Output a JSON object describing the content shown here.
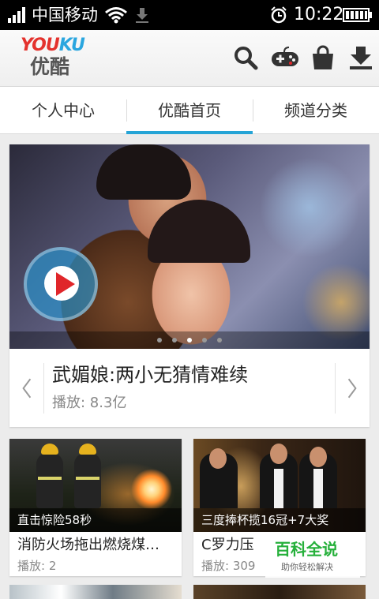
{
  "status_bar": {
    "carrier": "中国移动",
    "time": "10:22",
    "icons": [
      "signal-icon",
      "wifi-icon",
      "download-icon",
      "alarm-icon",
      "battery-icon"
    ]
  },
  "header": {
    "logo_en": "YOUKU",
    "logo_cn": "优酷",
    "brand_colors": {
      "you": "#e4322d",
      "ku": "#2aa6df"
    },
    "actions": [
      "search-icon",
      "game-controller-icon",
      "bag-icon",
      "download-icon"
    ]
  },
  "tabs": [
    {
      "label": "个人中心"
    },
    {
      "label": "优酷首页",
      "active": true
    },
    {
      "label": "频道分类"
    }
  ],
  "accent_color": "#25a4d6",
  "hero": {
    "title": "武媚娘:两小无猜情难续",
    "plays": "播放: 8.3亿",
    "slide_count": 5,
    "active_slide": 3
  },
  "videos": [
    {
      "caption": "直击惊险58秒",
      "title": "消防火场拖出燃烧煤…",
      "plays": "播放: 2"
    },
    {
      "caption": "三度捧杯揽16冠+7大奖",
      "title": "C罗力压",
      "plays": "播放: 309"
    }
  ],
  "watermark": {
    "main": "百科全说",
    "sub": "助你轻松解决"
  }
}
